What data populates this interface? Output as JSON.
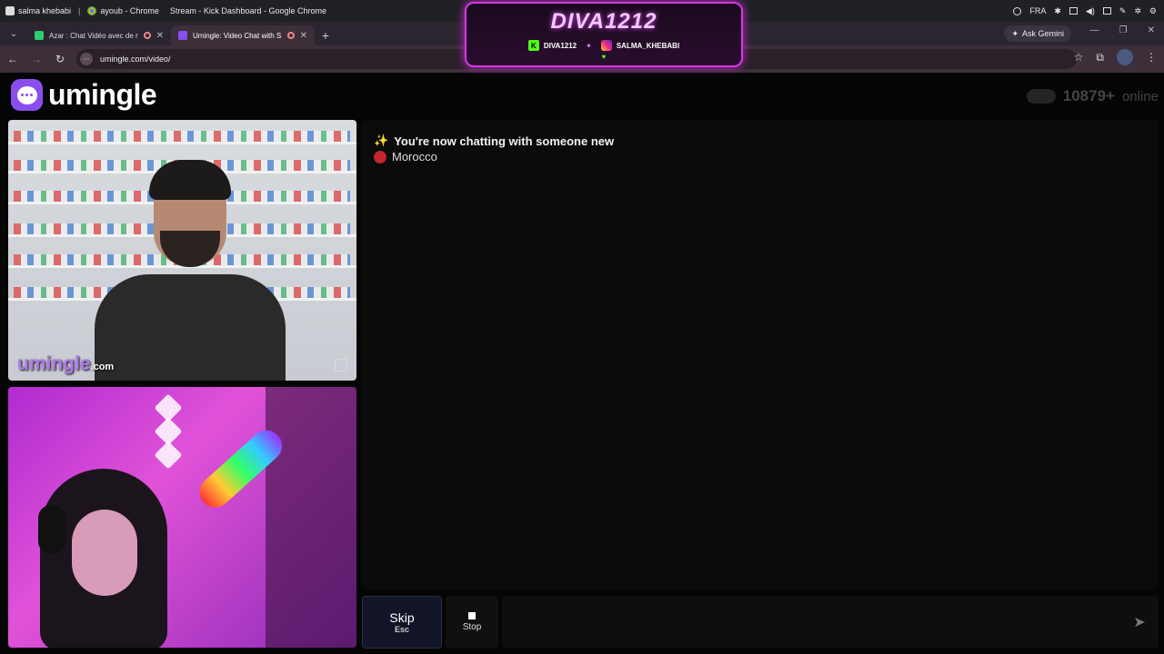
{
  "taskbar": {
    "items": [
      {
        "label": "salma khebabi"
      },
      {
        "label": "ayoub - Chrome"
      },
      {
        "label": "Stream - Kick Dashboard - Google Chrome"
      }
    ],
    "language": "FRA"
  },
  "tabs": [
    {
      "title": "Azar : Chat Vidéo avec de n",
      "active": false
    },
    {
      "title": "Umingle: Video Chat with S",
      "active": true
    }
  ],
  "toolbar": {
    "ask_gemini": "Ask Gemini",
    "url": "umingle.com/video/"
  },
  "overlay": {
    "title": "DIVA1212",
    "kick_handle": "DIVA1212",
    "instagram_handle": "SALMA_KHEBABI"
  },
  "site": {
    "logo_text": "umingle",
    "online_count": "10879+",
    "online_label": "online"
  },
  "video": {
    "watermark": "umingle",
    "watermark_suffix": ".com"
  },
  "chat": {
    "messages": [
      {
        "icon": "✨",
        "text": "You're now chatting with someone new"
      },
      {
        "icon": "flag-morocco",
        "text": "Morocco"
      }
    ]
  },
  "controls": {
    "skip_label": "Skip",
    "skip_key": "Esc",
    "stop_label": "Stop",
    "input_placeholder": ""
  },
  "colors": {
    "brand": "#8a4ef0",
    "overlay_accent": "#d23adf",
    "background": "#050505"
  }
}
